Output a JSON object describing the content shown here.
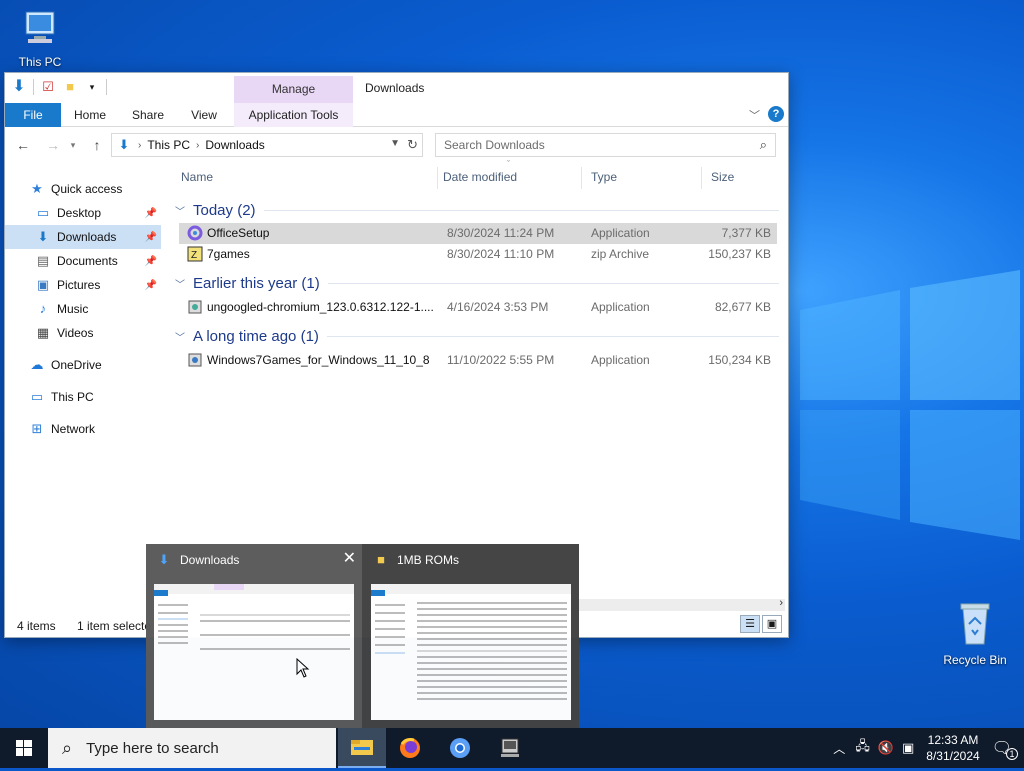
{
  "desktop": {
    "icons": [
      {
        "label": "This PC"
      },
      {
        "label": "Recycle Bin"
      }
    ]
  },
  "window": {
    "title": "Downloads",
    "manage_label": "Manage",
    "tabs": [
      "File",
      "Home",
      "Share",
      "View",
      "Application Tools"
    ],
    "breadcrumb": [
      "This PC",
      "Downloads"
    ],
    "search_placeholder": "Search Downloads",
    "columns": [
      "Name",
      "Date modified",
      "Type",
      "Size"
    ],
    "groups": [
      {
        "label": "Today (2)",
        "files": [
          {
            "name": "OfficeSetup",
            "date": "8/30/2024 11:24 PM",
            "type": "Application",
            "size": "7,377 KB",
            "icon": "office-icon",
            "selected": true
          },
          {
            "name": "7games",
            "date": "8/30/2024 11:10 PM",
            "type": "zip Archive",
            "size": "150,237 KB",
            "icon": "zip-icon",
            "selected": false
          }
        ]
      },
      {
        "label": "Earlier this year (1)",
        "files": [
          {
            "name": "ungoogled-chromium_123.0.6312.122-1....",
            "date": "4/16/2024 3:53 PM",
            "type": "Application",
            "size": "82,677 KB",
            "icon": "installer-icon",
            "selected": false
          }
        ]
      },
      {
        "label": "A long time ago (1)",
        "files": [
          {
            "name": "Windows7Games_for_Windows_11_10_8",
            "date": "11/10/2022 5:55 PM",
            "type": "Application",
            "size": "150,234 KB",
            "icon": "installer-icon",
            "selected": false
          }
        ]
      }
    ],
    "status": {
      "items": "4 items",
      "selected": "1 item selecte"
    }
  },
  "nav": {
    "items": [
      {
        "label": "Quick access",
        "icon": "star-icon",
        "pinned": false
      },
      {
        "label": "Desktop",
        "icon": "desktop-icon",
        "pinned": true
      },
      {
        "label": "Downloads",
        "icon": "download-icon",
        "pinned": true
      },
      {
        "label": "Documents",
        "icon": "documents-icon",
        "pinned": true
      },
      {
        "label": "Pictures",
        "icon": "pictures-icon",
        "pinned": true
      },
      {
        "label": "Music",
        "icon": "music-icon",
        "pinned": false
      },
      {
        "label": "Videos",
        "icon": "videos-icon",
        "pinned": false
      },
      {
        "label": "OneDrive",
        "icon": "cloud-icon",
        "pinned": false
      },
      {
        "label": "This PC",
        "icon": "computer-icon",
        "pinned": false
      },
      {
        "label": "Network",
        "icon": "network-icon",
        "pinned": false
      }
    ]
  },
  "previews": [
    {
      "title": "Downloads"
    },
    {
      "title": "1MB ROMs"
    }
  ],
  "taskbar": {
    "search_placeholder": "Type here to search",
    "time": "12:33 AM",
    "date": "8/31/2024",
    "notification_count": "1"
  },
  "colors": {
    "accent": "#1979ca",
    "manage": "#e8d7f5",
    "selection": "#cce0f5",
    "group_header": "#1e3a8a"
  }
}
